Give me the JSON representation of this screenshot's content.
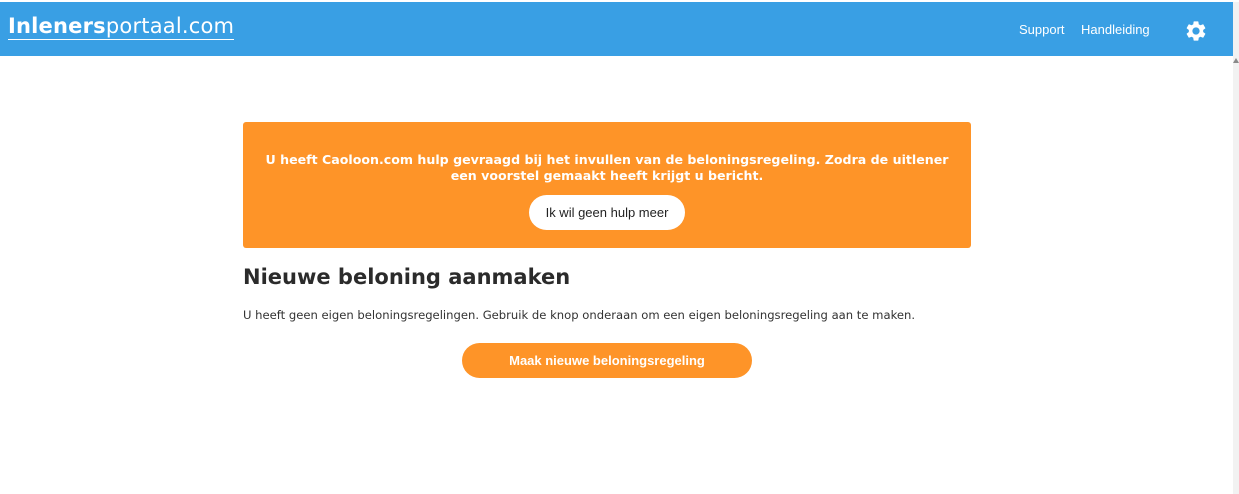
{
  "header": {
    "logo_bold": "Inleners",
    "logo_rest": "portaal.com",
    "nav": {
      "support": "Support",
      "handleiding": "Handleiding"
    },
    "settings_icon": "gear-icon",
    "background_color": "#399fe4"
  },
  "notice": {
    "message": "U heeft Caoloon.com hulp gevraagd bij het invullen van de beloningsregeling. Zodra de uitlener een voorstel gemaakt heeft krijgt u bericht.",
    "button_label": "Ik wil geen hulp meer",
    "background_color": "#fe9428"
  },
  "main": {
    "title": "Nieuwe beloning aanmaken",
    "info": "U heeft geen eigen beloningsregelingen. Gebruik de knop onderaan om een eigen beloningsregeling aan te maken.",
    "new_button_label": "Maak nieuwe beloningsregeling",
    "accent_color": "#fe9428"
  }
}
